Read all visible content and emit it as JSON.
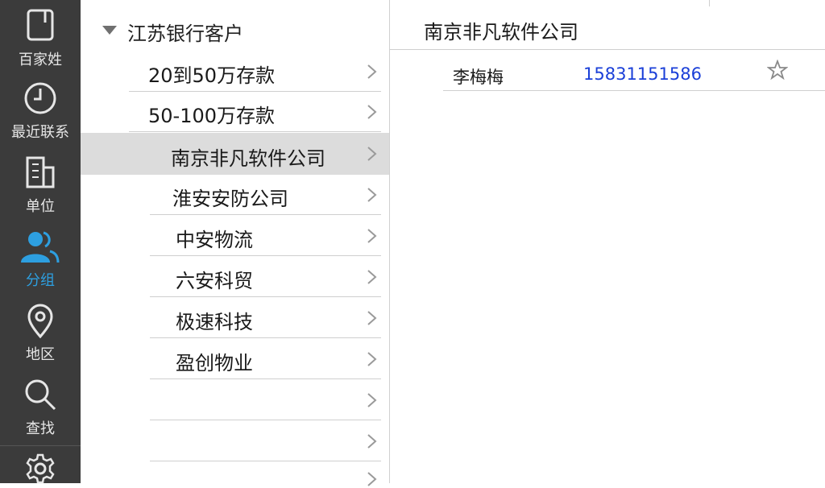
{
  "sidebar": {
    "items": [
      {
        "label": "百家姓",
        "icon": "book-icon"
      },
      {
        "label": "最近联系",
        "icon": "clock-icon"
      },
      {
        "label": "单位",
        "icon": "building-icon"
      },
      {
        "label": "分组",
        "icon": "group-icon",
        "active": true
      },
      {
        "label": "地区",
        "icon": "location-pin-icon"
      },
      {
        "label": "查找",
        "icon": "search-icon"
      },
      {
        "label": "",
        "icon": "gear-icon"
      }
    ],
    "active_color": "#2d9fe0"
  },
  "tree": {
    "root_label": "江苏银行客户",
    "groups": [
      {
        "label": "20到50万存款"
      },
      {
        "label": "50-100万存款"
      }
    ],
    "companies": [
      {
        "label": "南京非凡软件公司",
        "selected": true
      },
      {
        "label": "淮安安防公司"
      },
      {
        "label": "中安物流"
      },
      {
        "label": "六安科贸"
      },
      {
        "label": "极速科技"
      },
      {
        "label": "盈创物业"
      },
      {
        "label": ""
      },
      {
        "label": ""
      },
      {
        "label": ""
      }
    ]
  },
  "detail": {
    "title": "南京非凡软件公司",
    "contacts": [
      {
        "name": "李梅梅",
        "phone": "15831151586"
      }
    ],
    "phone_color": "#1a3fd8"
  }
}
